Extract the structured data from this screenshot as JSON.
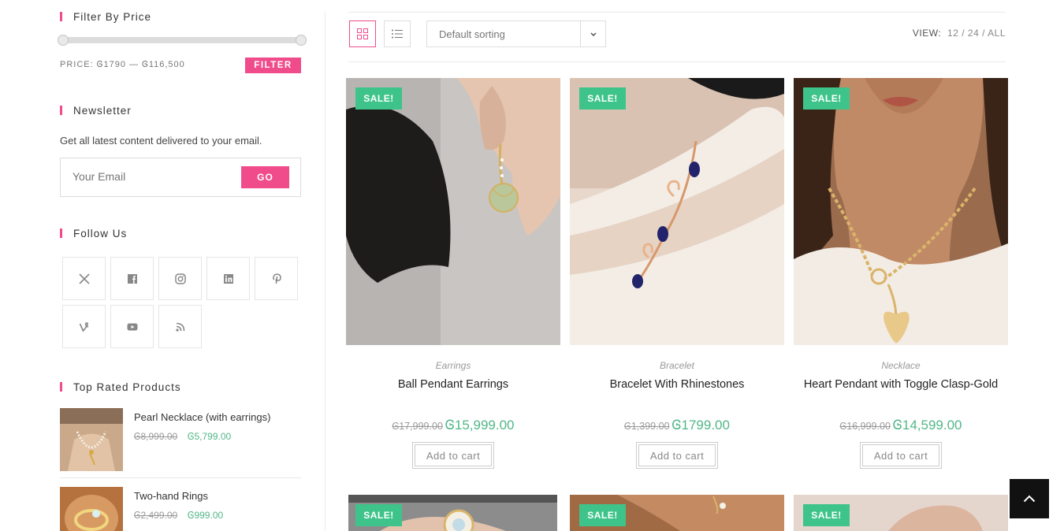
{
  "sidebar": {
    "filter_title": "Filter By Price",
    "price_label": "PRICE: Ꮆ1790 — Ꮆ116,500",
    "filter_button": "FILTER",
    "newsletter_title": "Newsletter",
    "newsletter_text": "Get all latest content delivered to your email.",
    "email_placeholder": "Your Email",
    "go_button": "GO",
    "follow_title": "Follow Us",
    "social_icons": [
      "x-icon",
      "facebook-icon",
      "instagram-icon",
      "linkedin-icon",
      "pinterest-icon",
      "vine-icon",
      "youtube-icon",
      "rss-icon"
    ],
    "top_rated_title": "Top Rated Products",
    "top_rated": [
      {
        "name": "Pearl Necklace (with earrings)",
        "old_price": "Ꮆ8,999.00",
        "new_price": "Ꮆ5,799.00"
      },
      {
        "name": "Two-hand Rings",
        "old_price": "Ꮆ2,499.00",
        "new_price": "Ꮆ999.00"
      }
    ]
  },
  "toolbar": {
    "sort_label": "Default sorting",
    "view_label": "VIEW:",
    "view_12": "12",
    "view_24": "24",
    "view_all": "ALL",
    "sep": "/"
  },
  "products": [
    {
      "sale": "SALE!",
      "category": "Earrings",
      "name": "Ball Pendant Earrings",
      "old_price": "Ꮆ17,999.00",
      "new_price": "Ꮆ15,999.00",
      "cart": "Add to cart"
    },
    {
      "sale": "SALE!",
      "category": "Bracelet",
      "name": "Bracelet With Rhinestones",
      "old_price": "Ꮆ1,399.00",
      "new_price": "Ꮆ1799.00",
      "cart": "Add to cart"
    },
    {
      "sale": "SALE!",
      "category": "Necklace",
      "name": "Heart Pendant with Toggle Clasp-Gold",
      "old_price": "Ꮆ16,999.00",
      "new_price": "Ꮆ14,599.00",
      "cart": "Add to cart"
    }
  ],
  "products_row2": [
    {
      "sale": "SALE!"
    },
    {
      "sale": "SALE!"
    },
    {
      "sale": "SALE!"
    }
  ],
  "colors": {
    "accent": "#f04c8c",
    "sale": "#3ec48a",
    "price": "#52b788"
  }
}
